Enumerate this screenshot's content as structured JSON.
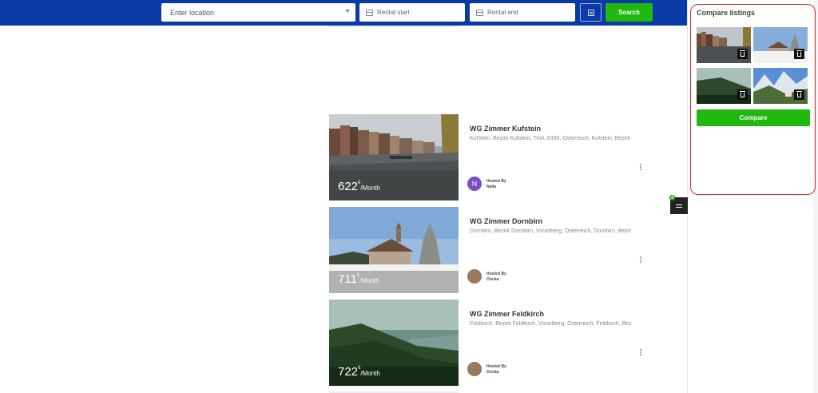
{
  "search": {
    "location_placeholder": "Enter location",
    "rental_start_placeholder": "Rental start",
    "rental_end_placeholder": "Rental end",
    "search_label": "Search"
  },
  "listings": [
    {
      "title": "WG Zimmer Kufstein",
      "address": "Kufstein, Bezirk Kufstein, Tirol, 6330, Österreich, Kufstein, Bezirk",
      "price": "622",
      "currency": "€",
      "period": "/Month",
      "hosted_by": "Hosted By",
      "host": "Naila",
      "host_initial": "N"
    },
    {
      "title": "WG Zimmer Dornbirn",
      "address": "Dornbirn, Bezirk Dornbirn, Vorarlberg, Österreich, Dornbirn, Bezir",
      "price": "711",
      "currency": "€",
      "period": "/Month",
      "hosted_by": "Hosted By",
      "host": "Oncka"
    },
    {
      "title": "WG Zimmer Feldkirch",
      "address": "Feldkirch, Bezirk Feldkirch, Vorarlberg, Österreich, Feldkirch, Bez",
      "price": "722",
      "currency": "€",
      "period": "/Month",
      "hosted_by": "Hosted By",
      "host": "Oncka"
    }
  ],
  "compare": {
    "title": "Compare listings",
    "button_label": "Compare",
    "count_badge": "4"
  },
  "colors": {
    "header_bg": "#0a3aa6",
    "accent_green": "#21b80f",
    "highlight_red": "#d62b2b"
  }
}
